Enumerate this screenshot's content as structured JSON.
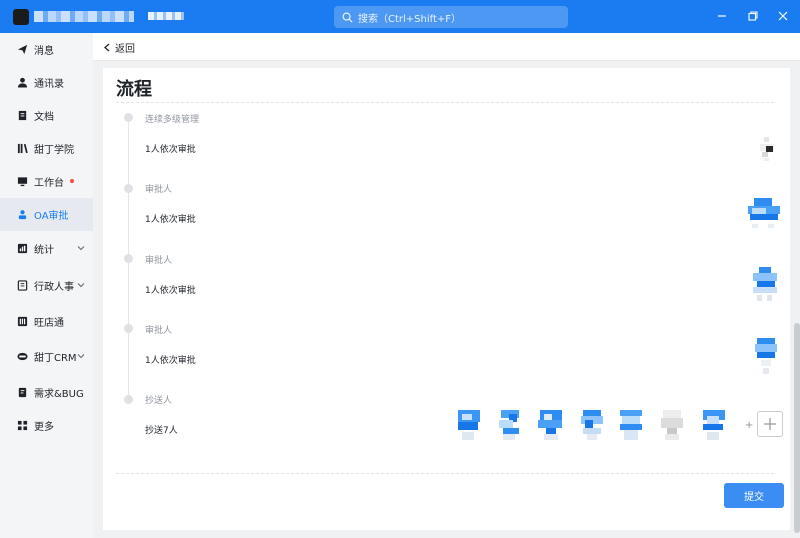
{
  "titlebar": {
    "search_placeholder": "搜索（Ctrl+Shift+F）"
  },
  "sidebar": {
    "items": [
      {
        "label": "消息",
        "icon": "send-icon"
      },
      {
        "label": "通讯录",
        "icon": "contact-icon"
      },
      {
        "label": "文档",
        "icon": "document-icon"
      },
      {
        "label": "甜丁学院",
        "icon": "library-icon"
      },
      {
        "label": "工作台",
        "icon": "monitor-icon",
        "badge": true
      },
      {
        "label": "OA审批",
        "icon": "approval-icon",
        "active": true
      },
      {
        "label": "统计",
        "icon": "chart-icon",
        "expandable": true
      },
      {
        "label": "行政人事",
        "icon": "hr-icon",
        "expandable": true
      },
      {
        "label": "旺店通",
        "icon": "store-icon"
      },
      {
        "label": "甜丁CRM",
        "icon": "crm-icon",
        "expandable": true
      },
      {
        "label": "需求&BUG",
        "icon": "bug-icon"
      },
      {
        "label": "更多",
        "icon": "grid-icon"
      }
    ]
  },
  "topbar": {
    "back_label": "返回"
  },
  "process": {
    "title": "流程",
    "steps": [
      {
        "label": "连续多级管理",
        "desc": "1人依次审批"
      },
      {
        "label": "审批人",
        "desc": "1人依次审批"
      },
      {
        "label": "审批人",
        "desc": "1人依次审批"
      },
      {
        "label": "审批人",
        "desc": "1人依次审批"
      },
      {
        "label": "抄送人",
        "desc": "抄送7人"
      }
    ],
    "plus_sign": "+"
  },
  "actions": {
    "submit_label": "提交"
  },
  "colors": {
    "accent": "#1a7cf0",
    "submit": "#3b8cf3"
  }
}
